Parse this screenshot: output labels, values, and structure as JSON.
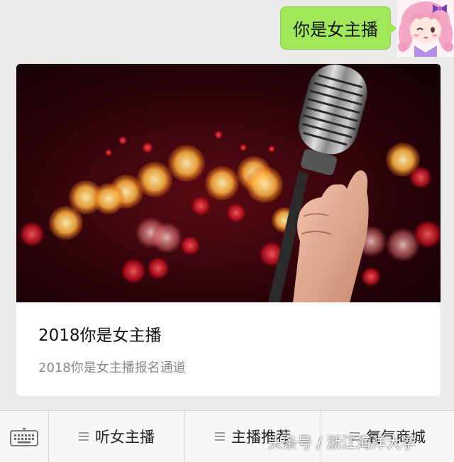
{
  "message": {
    "text": "你是女主播"
  },
  "card": {
    "image_icon": "microphone-bokeh-image",
    "title": "2018你是女主播",
    "description": "2018你是女主播报名通道"
  },
  "menu": {
    "keyboard_icon": "keyboard-icon",
    "items": [
      {
        "label": "听女主播",
        "icon": "menu-lines-icon"
      },
      {
        "label": "主播推荐",
        "icon": "menu-lines-icon"
      },
      {
        "label": "氧气商城",
        "icon": "menu-lines-icon"
      }
    ]
  },
  "watermark": {
    "text": "头条号 / 浙江海洋大学"
  },
  "colors": {
    "bubble": "#a0e75a",
    "background": "#ebebeb",
    "card": "#ffffff",
    "menubar": "#f7f7f7"
  }
}
